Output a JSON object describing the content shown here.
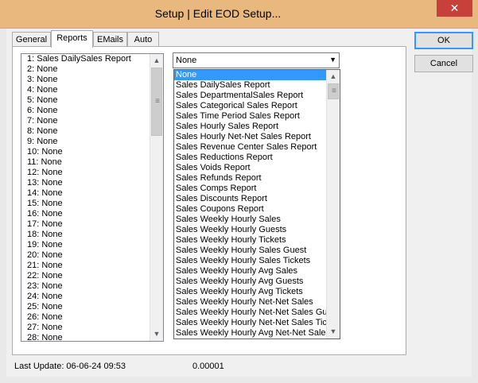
{
  "window": {
    "title": "Setup | Edit EOD Setup...",
    "close_glyph": "✕"
  },
  "tabs": [
    {
      "label": "General"
    },
    {
      "label": "Reports"
    },
    {
      "label": "EMails"
    },
    {
      "label": "Auto"
    }
  ],
  "report_slots": [
    "1: Sales DailySales Report",
    "2: None",
    "3: None",
    "4: None",
    "5: None",
    "6: None",
    "7: None",
    "8: None",
    "9: None",
    "10: None",
    "11: None",
    "12: None",
    "13: None",
    "14: None",
    "15: None",
    "16: None",
    "17: None",
    "18: None",
    "19: None",
    "20: None",
    "21: None",
    "22: None",
    "23: None",
    "24: None",
    "25: None",
    "26: None",
    "27: None",
    "28: None"
  ],
  "report_combo": {
    "value": "None",
    "options": [
      "None",
      "Sales DailySales Report",
      "Sales DepartmentalSales Report",
      "Sales Categorical Sales Report",
      "Sales Time Period Sales Report",
      "Sales Hourly Sales Report",
      "Sales Hourly Net-Net Sales Report",
      "Sales Revenue Center Sales Report",
      "Sales Reductions Report",
      "Sales Voids Report",
      "Sales Refunds Report",
      "Sales Comps Report",
      "Sales Discounts Report",
      "Sales Coupons Report",
      "Sales Weekly Hourly Sales",
      "Sales Weekly Hourly Guests",
      "Sales Weekly Hourly Tickets",
      "Sales Weekly Hourly Sales Guest",
      "Sales Weekly Hourly Sales Tickets",
      "Sales Weekly Hourly Avg Sales",
      "Sales Weekly Hourly Avg Guests",
      "Sales Weekly Hourly Avg Tickets",
      "Sales Weekly Hourly Net-Net Sales",
      "Sales Weekly Hourly Net-Net Sales Guest",
      "Sales Weekly Hourly Net-Net Sales Tickets",
      "Sales Weekly Hourly Avg Net-Net Sales"
    ]
  },
  "buttons": {
    "ok": "OK",
    "cancel": "Cancel"
  },
  "status": {
    "last_update": "Last Update: 06-06-24 09:53",
    "value": "0.00001"
  },
  "icons": {
    "scroll_up": "▲",
    "scroll_down": "▼",
    "grip": "≡",
    "dropdown": "▼"
  },
  "colors": {
    "title_bar": "#e8b87f",
    "close_button": "#c7403a",
    "selection": "#3399ff"
  }
}
